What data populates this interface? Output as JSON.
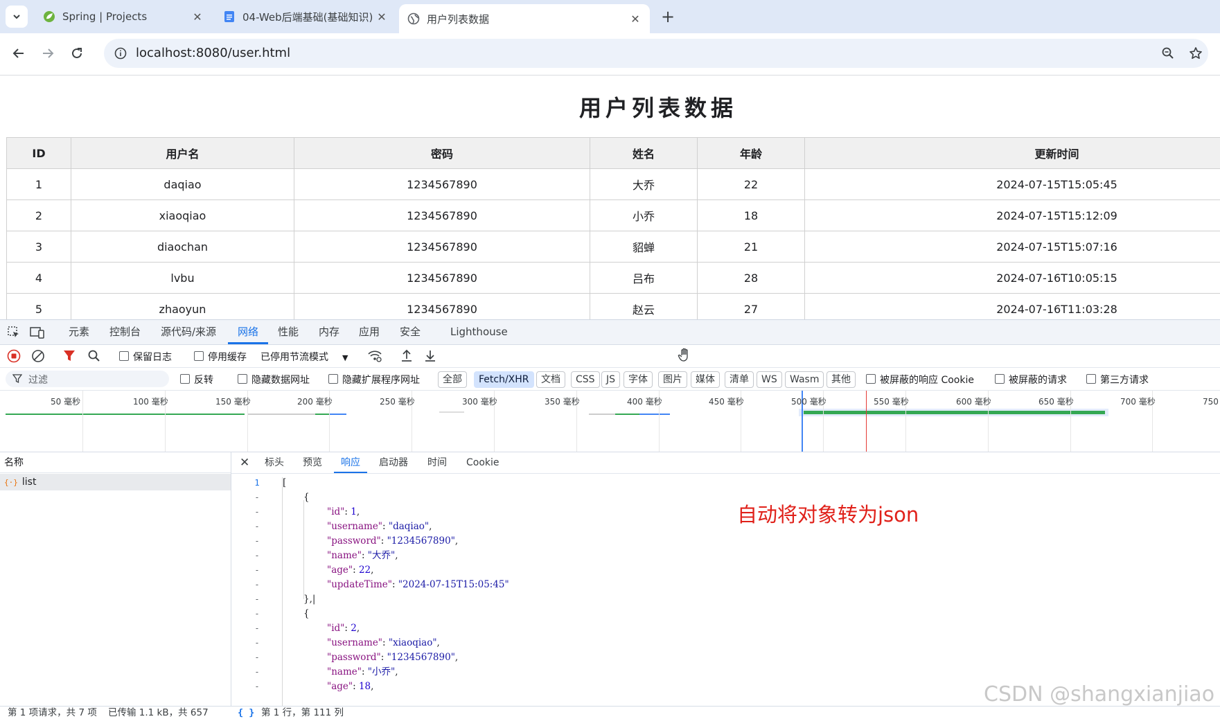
{
  "browser": {
    "tabs": [
      {
        "title": "Spring | Projects",
        "icon": "spring-leaf-icon"
      },
      {
        "title": "04-Web后端基础(基础知识) -",
        "icon": "docs-icon"
      },
      {
        "title": "用户列表数据",
        "icon": "globe-icon",
        "active": true
      }
    ],
    "url": "localhost:8080/user.html"
  },
  "page": {
    "title": "用户列表数据",
    "columns": [
      "ID",
      "用户名",
      "密码",
      "姓名",
      "年龄",
      "更新时间"
    ],
    "rows": [
      [
        "1",
        "daqiao",
        "1234567890",
        "大乔",
        "22",
        "2024-07-15T15:05:45"
      ],
      [
        "2",
        "xiaoqiao",
        "1234567890",
        "小乔",
        "18",
        "2024-07-15T15:12:09"
      ],
      [
        "3",
        "diaochan",
        "1234567890",
        "貂蝉",
        "21",
        "2024-07-15T15:07:16"
      ],
      [
        "4",
        "lvbu",
        "1234567890",
        "吕布",
        "28",
        "2024-07-16T10:05:15"
      ],
      [
        "5",
        "zhaoyun",
        "1234567890",
        "赵云",
        "27",
        "2024-07-16T11:03:28"
      ]
    ]
  },
  "devtools": {
    "tabs": [
      "元素",
      "控制台",
      "源代码/来源",
      "网络",
      "性能",
      "内存",
      "应用",
      "安全",
      "Lighthouse"
    ],
    "active_tab": "网络",
    "toolbar1": {
      "preserve_log": "保留日志",
      "disable_cache": "停用缓存",
      "throttle": "已停用节流模式"
    },
    "toolbar2": {
      "filter_placeholder": "过滤",
      "invert": "反转",
      "hide_data_urls": "隐藏数据网址",
      "hide_ext_urls": "隐藏扩展程序网址",
      "types": [
        "全部",
        "Fetch/XHR",
        "文档",
        "CSS",
        "JS",
        "字体",
        "图片",
        "媒体",
        "清单",
        "WS",
        "Wasm",
        "其他"
      ],
      "active_type": "Fetch/XHR",
      "blocked_cookies": "被屏蔽的响应 Cookie",
      "blocked_requests": "被屏蔽的请求",
      "third_party": "第三方请求"
    },
    "timeline_ticks": [
      "50 毫秒",
      "100 毫秒",
      "150 毫秒",
      "200 毫秒",
      "250 毫秒",
      "300 毫秒",
      "350 毫秒",
      "400 毫秒",
      "450 毫秒",
      "500 毫秒",
      "550 毫秒",
      "600 毫秒",
      "650 毫秒",
      "700 毫秒",
      "750 毫"
    ],
    "request_list": {
      "header": "名称",
      "items": [
        "list"
      ]
    },
    "detail_tabs": [
      "标头",
      "预览",
      "响应",
      "启动器",
      "时间",
      "Cookie"
    ],
    "active_detail_tab": "响应",
    "response_lines": [
      {
        "n": "1",
        "indent": 0,
        "text": "["
      },
      {
        "n": "-",
        "indent": 1,
        "text": "{"
      },
      {
        "n": "-",
        "indent": 2,
        "key": "\"id\"",
        "val": "1",
        "type": "num"
      },
      {
        "n": "-",
        "indent": 2,
        "key": "\"username\"",
        "val": "\"daqiao\"",
        "type": "str"
      },
      {
        "n": "-",
        "indent": 2,
        "key": "\"password\"",
        "val": "\"1234567890\"",
        "type": "str"
      },
      {
        "n": "-",
        "indent": 2,
        "key": "\"name\"",
        "val": "\"大乔\"",
        "type": "str"
      },
      {
        "n": "-",
        "indent": 2,
        "key": "\"age\"",
        "val": "22",
        "type": "num"
      },
      {
        "n": "-",
        "indent": 2,
        "key": "\"updateTime\"",
        "val": "\"2024-07-15T15:05:45\"",
        "type": "str",
        "last": true
      },
      {
        "n": "-",
        "indent": 1,
        "text": "},|"
      },
      {
        "n": "-",
        "indent": 1,
        "text": "{"
      },
      {
        "n": "-",
        "indent": 2,
        "key": "\"id\"",
        "val": "2",
        "type": "num"
      },
      {
        "n": "-",
        "indent": 2,
        "key": "\"username\"",
        "val": "\"xiaoqiao\"",
        "type": "str"
      },
      {
        "n": "-",
        "indent": 2,
        "key": "\"password\"",
        "val": "\"1234567890\"",
        "type": "str"
      },
      {
        "n": "-",
        "indent": 2,
        "key": "\"name\"",
        "val": "\"小乔\"",
        "type": "str"
      },
      {
        "n": "-",
        "indent": 2,
        "key": "\"age\"",
        "val": "18",
        "type": "num"
      }
    ],
    "annotation": "自动将对象转为json",
    "status": {
      "requests": "第 1 项请求，共 7 项",
      "transferred": "已传输 1.1 kB，共 657",
      "position": "第 1 行，第 111 列"
    }
  },
  "watermark": "CSDN @shangxianjiao"
}
